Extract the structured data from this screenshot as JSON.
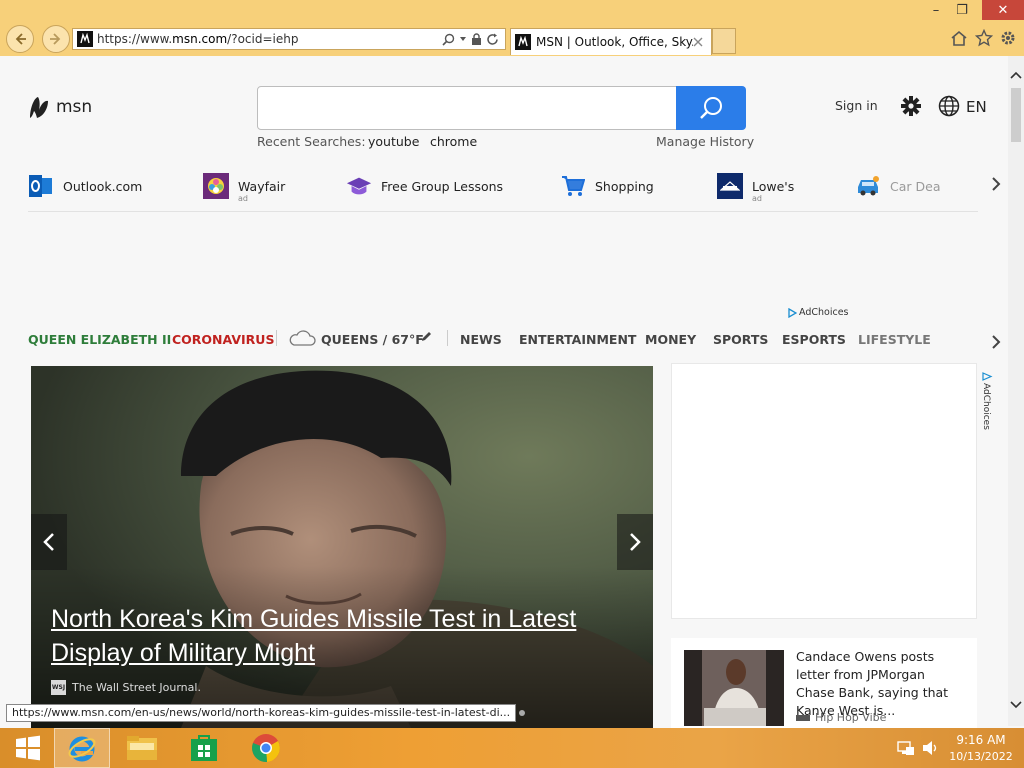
{
  "browser": {
    "address": {
      "prefix": "https://www.",
      "domain": "msn.com",
      "rest": "/?ocid=iehp"
    },
    "tab_title": "MSN | Outlook, Office, Sky...",
    "window_controls": {
      "minimize": "–",
      "restore": "❐",
      "close": "✕"
    }
  },
  "header": {
    "logo_text": "msn",
    "recent_label": "Recent Searches:",
    "recent_searches": [
      "youtube",
      "chrome"
    ],
    "manage_history": "Manage History",
    "sign_in": "Sign in",
    "language": "EN"
  },
  "quick_links": [
    {
      "label": "Outlook.com",
      "ad": ""
    },
    {
      "label": "Wayfair",
      "ad": "ad"
    },
    {
      "label": "Free Group Lessons",
      "ad": ""
    },
    {
      "label": "Shopping",
      "ad": ""
    },
    {
      "label": "Lowe's",
      "ad": "ad"
    },
    {
      "label": "Car Deal",
      "ad": ""
    }
  ],
  "ad_choices": "AdChoices",
  "nav": {
    "queen": "QUEEN ELIZABETH II",
    "coronavirus": "CORONAVIRUS",
    "weather": "QUEENS / 67°F",
    "items": [
      "NEWS",
      "ENTERTAINMENT",
      "MONEY",
      "SPORTS",
      "ESPORTS",
      "LIFESTYLE"
    ]
  },
  "hero": {
    "title": "North Korea's Kim Guides Missile Test in Latest Display of Military Might",
    "source_logo": "WSJ",
    "source": "The Wall Street Journal."
  },
  "card": {
    "title": "Candace Owens posts letter from JPMorgan Chase Bank, saying that Kanye West is...",
    "source": "Hip Hop Vibe"
  },
  "status_url": "https://www.msn.com/en-us/news/world/north-koreas-kim-guides-missile-test-in-latest-di...",
  "taskbar": {
    "time": "9:16 AM",
    "date": "10/13/2022"
  }
}
